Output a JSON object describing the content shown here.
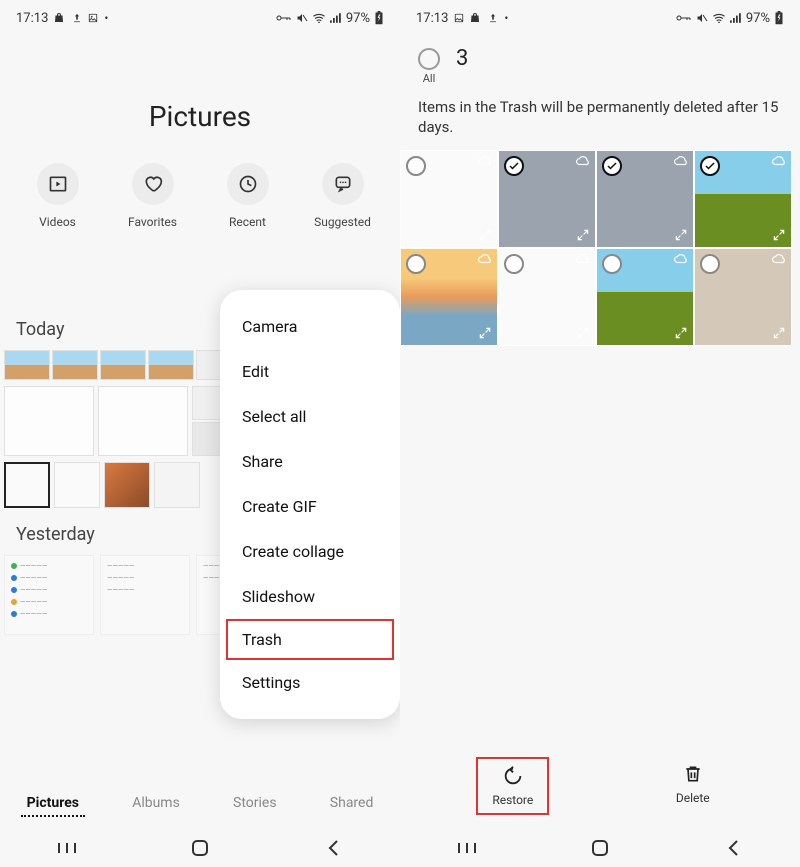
{
  "status": {
    "time": "17:13",
    "battery": "97%"
  },
  "screen1": {
    "title": "Pictures",
    "shortcuts": [
      {
        "label": "Videos",
        "icon": "videos-icon"
      },
      {
        "label": "Favorites",
        "icon": "heart-icon"
      },
      {
        "label": "Recent",
        "icon": "clock-icon"
      },
      {
        "label": "Suggested",
        "icon": "suggest-icon"
      }
    ],
    "sections": {
      "today": "Today",
      "yesterday": "Yesterday"
    },
    "tabs": [
      {
        "label": "Pictures",
        "active": true
      },
      {
        "label": "Albums",
        "active": false
      },
      {
        "label": "Stories",
        "active": false
      },
      {
        "label": "Shared",
        "active": false
      }
    ],
    "menu": [
      "Camera",
      "Edit",
      "Select all",
      "Share",
      "Create GIF",
      "Create collage",
      "Slideshow",
      "Trash",
      "Settings"
    ],
    "menu_highlight": "Trash"
  },
  "screen2": {
    "all_label": "All",
    "selected_count": "3",
    "message": "Items in the Trash will be permanently deleted after 15 days.",
    "items": [
      {
        "selected": false,
        "bg": "bg-white"
      },
      {
        "selected": true,
        "bg": "bg-gray"
      },
      {
        "selected": true,
        "bg": "bg-gray"
      },
      {
        "selected": true,
        "bg": "bg-landscape"
      },
      {
        "selected": false,
        "bg": "bg-sunset"
      },
      {
        "selected": false,
        "bg": "bg-white"
      },
      {
        "selected": false,
        "bg": "bg-landscape"
      },
      {
        "selected": false,
        "bg": "bg-door"
      }
    ],
    "actions": {
      "restore": "Restore",
      "delete": "Delete"
    },
    "action_highlight": "restore"
  }
}
